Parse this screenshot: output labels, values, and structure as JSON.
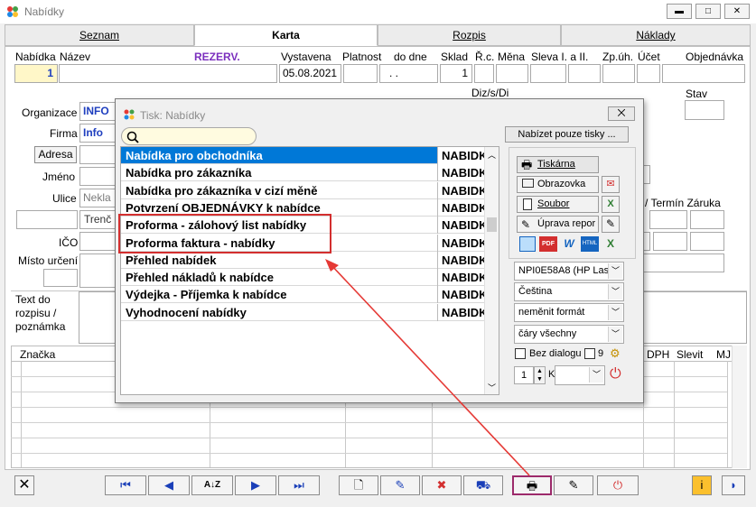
{
  "window": {
    "title": "Nabídky"
  },
  "tabs": [
    "Seznam",
    "Karta",
    "Rozpis",
    "Náklady"
  ],
  "header_labels": {
    "nabidka": "Nabídka",
    "nazev": "Název",
    "rezerv": "REZERV.",
    "vystavena": "Vystavena",
    "platnost": "Platnost",
    "do_dne": "do dne",
    "sklad": "Sklad",
    "rc": "Ř.c.",
    "mena": "Měna",
    "sleva": "Sleva I. a II.",
    "zpuh": "Zp.úh.",
    "ucet": "Účet",
    "objednavka": "Objednávka"
  },
  "header_values": {
    "nabidka": "1",
    "vystavena": "05.08.2021",
    "do_dne": ". .",
    "sklad": "1"
  },
  "form_labels": {
    "dzsdi": "Diz/s/Di",
    "stav": "Stav",
    "organizace": "Organizace",
    "firma": "Firma",
    "adresa": "Adresa",
    "jmeno": "Jméno",
    "ulice": "Ulice",
    "ico": "IČO",
    "misto": "Místo určení",
    "termin": "/ Termín Záruka",
    "text1": "Text do",
    "text2": "rozpisu /",
    "text3": "poznámka"
  },
  "form_values": {
    "organizace": "INFO",
    "firma": "Info",
    "ulice": "Nekla",
    "mesto": "Trenč"
  },
  "grid_headers": {
    "znacka": "Značka",
    "dph": "DPH",
    "slevit": "Slevit",
    "mj": "MJ"
  },
  "dialog": {
    "title": "Tisk: Nabídky",
    "close_label": "⨉",
    "search_placeholder": "",
    "filter_button": "Nabízet pouze tisky ...",
    "items": [
      {
        "name": "Nabídka pro obchodníka",
        "code": "NABIDK"
      },
      {
        "name": "Nabídka pro zákazníka",
        "code": "NABIDK"
      },
      {
        "name": "Nabídka pro zákazníka v cizí měně",
        "code": "NABIDK"
      },
      {
        "name": "Potvrzení OBJEDNÁVKY k nabídce",
        "code": "NABIDK"
      },
      {
        "name": "Proforma - zálohový list nabídky",
        "code": "NABIDK"
      },
      {
        "name": "Proforma faktura - nabídky",
        "code": "NABIDK"
      },
      {
        "name": "Přehled nabídek",
        "code": "NABIDK"
      },
      {
        "name": "Přehled nákladů k nabídce",
        "code": "NABIDK"
      },
      {
        "name": "Výdejka - Příjemka k nabídce",
        "code": "NABIDK"
      },
      {
        "name": "Vyhodnocení nabídky",
        "code": "NABIDK"
      }
    ],
    "buttons": {
      "tiskarna": "Tiskárna",
      "obrazovka": "Obrazovka",
      "soubor": "Soubor",
      "uprava": "Úprava repor"
    },
    "printer": "NPI0E58A8 (HP Lase",
    "language": "Čeština",
    "format": "neměnit formát",
    "lines": "čáry všechny",
    "bez_dialogu": "Bez dialogu",
    "nine": "9",
    "copies": "1",
    "k_label": "K"
  },
  "colors": {
    "highlight_box": "#d32f2f",
    "arrow": "#e53935",
    "selected_row": "#0078d7",
    "info_text": "#1f3fbf",
    "rezerv": "#7b2fbe"
  }
}
